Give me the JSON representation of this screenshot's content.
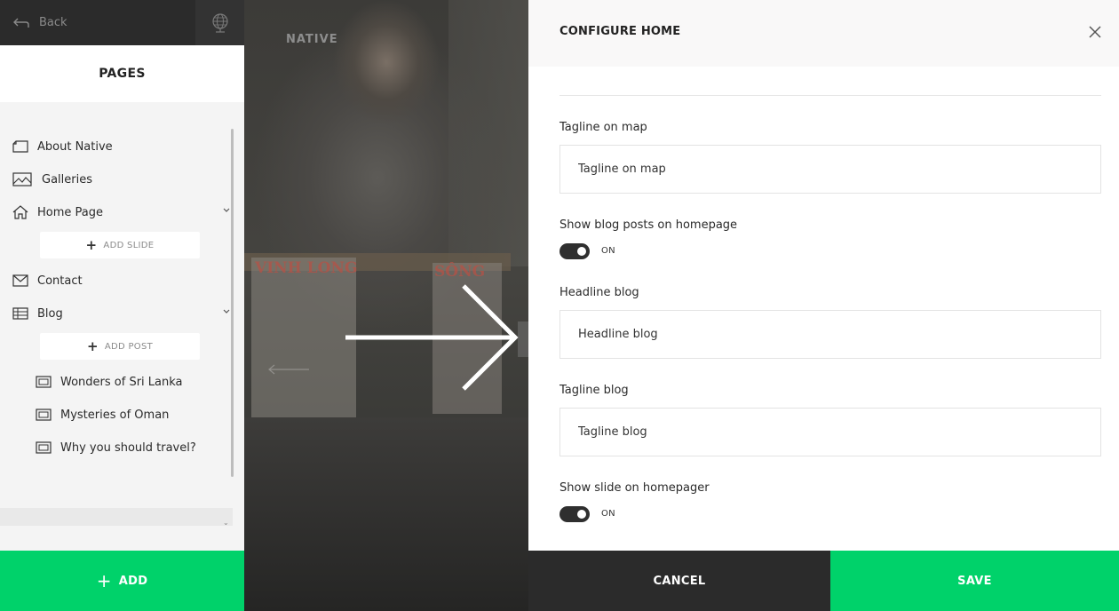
{
  "topbar": {
    "back_label": "Back",
    "back_icon": "back-arrow-icon",
    "globe_icon": "globe-icon"
  },
  "sidebar": {
    "title": "PAGES",
    "items": [
      {
        "label": "About Native",
        "icon": "page-icon"
      },
      {
        "label": "Galleries",
        "icon": "image-icon"
      },
      {
        "label": "Home Page",
        "icon": "home-icon",
        "expanded": true
      },
      {
        "label": "Contact",
        "icon": "mail-icon"
      },
      {
        "label": "Blog",
        "icon": "list-icon",
        "expanded": true
      }
    ],
    "add_slide_label": "ADD SLIDE",
    "add_post_label": "ADD POST",
    "posts": [
      {
        "label": "Wonders of Sri Lanka"
      },
      {
        "label": "Mysteries of Oman"
      },
      {
        "label": "Why you should travel?"
      }
    ],
    "add_label": "ADD"
  },
  "preview": {
    "brand": "NATIVE",
    "sign_left": "VINH LONG",
    "sign_right": "SÔNG"
  },
  "panel": {
    "title": "CONFIGURE HOME",
    "fields": {
      "tagline_map": {
        "label": "Tagline on map",
        "value": "Tagline on map"
      },
      "show_blog": {
        "label": "Show blog posts on homepage",
        "state": "ON"
      },
      "headline_blog": {
        "label": "Headline blog",
        "value": "Headline blog"
      },
      "tagline_blog": {
        "label": "Tagline blog",
        "value": "Tagline blog"
      },
      "show_slide": {
        "label": "Show slide on homepager",
        "state": "ON"
      }
    },
    "cancel_label": "CANCEL",
    "save_label": "SAVE"
  },
  "colors": {
    "accent_green": "#00d26a",
    "dark": "#2b2b2b"
  }
}
